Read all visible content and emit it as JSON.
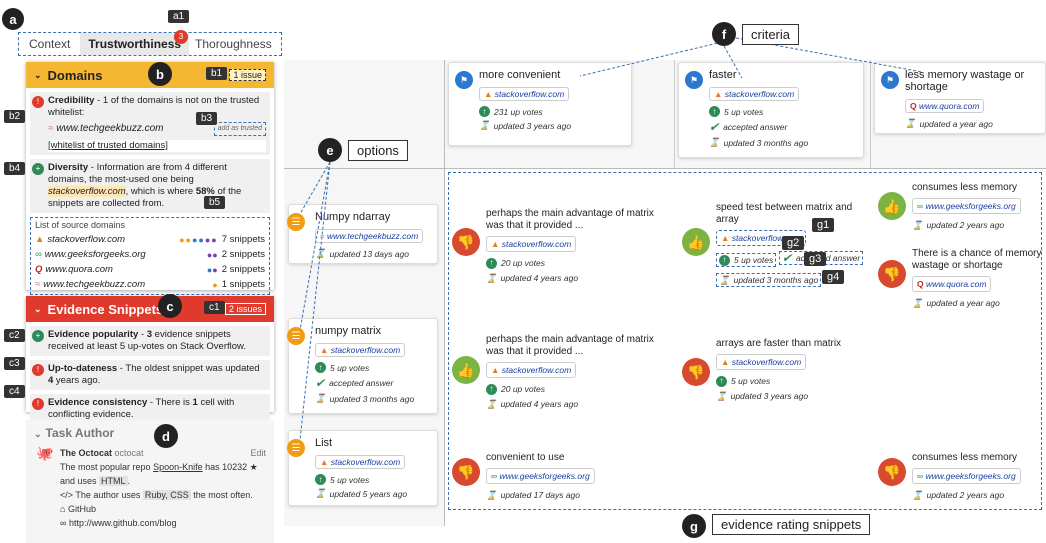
{
  "tabs": [
    "Context",
    "Trustworthiness",
    "Thoroughness"
  ],
  "tab_badge": "3",
  "labels": {
    "a": "a",
    "a1": "a1",
    "b": "b",
    "b1": "b1",
    "b2": "b2",
    "b3": "b3",
    "b4": "b4",
    "b5": "b5",
    "c": "c",
    "c1": "c1",
    "c2": "c2",
    "c3": "c3",
    "c4": "c4",
    "d": "d",
    "e": "e",
    "f": "f",
    "g": "g",
    "g1": "g1",
    "g2": "g2",
    "g3": "g3",
    "g4": "g4"
  },
  "callouts": {
    "criteria": "criteria",
    "options": "options",
    "evidence": "evidence rating snippets"
  },
  "domains": {
    "title": "Domains",
    "issues": "1 issue",
    "credibility_bold": "Credibility",
    "credibility_text": " - 1 of the domains is not on the trusted whitelist:",
    "cred_site": "www.techgeekbuzz.com",
    "add_trusted": "add as trusted",
    "whitelist": "[whitelist of trusted domains]",
    "diversity_bold": "Diversity",
    "diversity_text1": " - Information are from 4 different domains, the most-used one being ",
    "diversity_site": "stackoverflow.com",
    "diversity_text2": ", which is where ",
    "diversity_pct": "58%",
    "diversity_text3": " of the snippets are collected from.",
    "list_title": "List of source domains",
    "sources": [
      {
        "name": "stackoverflow.com",
        "count": "7 snippets"
      },
      {
        "name": "www.geeksforgeeks.org",
        "count": "2 snippets"
      },
      {
        "name": "www.quora.com",
        "count": "2 snippets"
      },
      {
        "name": "www.techgeekbuzz.com",
        "count": "1 snippets"
      }
    ]
  },
  "evidence": {
    "title": "Evidence Snippets",
    "issues": "2 issues",
    "pop_bold": "Evidence popularity",
    "pop_text1": " - ",
    "pop_n": "3",
    "pop_text2": " evidence snippets received at least 5 up-votes on Stack Overflow.",
    "up_bold": "Up-to-dateness",
    "up_text1": " - The oldest snippet was updated ",
    "up_n": "4",
    "up_text2": " years ago.",
    "con_bold": "Evidence consistency",
    "con_text1": " - There is ",
    "con_n": "1",
    "con_text2": " cell with conflicting evidence."
  },
  "author": {
    "title": "Task Author",
    "name": "The Octocat",
    "handle": "octocat",
    "edit": "Edit",
    "repo_text1": "The most popular repo ",
    "repo": "Spoon-Knife",
    "repo_text2": " has 10232 ★ and uses ",
    "lang": "HTML",
    ".": ".",
    "uses_text1": "The author uses ",
    "uses_langs": "Ruby, CSS",
    "uses_text2": " the most often.",
    "github": "GitHub",
    "blog": "http://www.github.com/blog"
  },
  "criteria": [
    {
      "title": "more convenient",
      "site": "stackoverflow.com",
      "votes": "231 up votes",
      "updated": "updated 3 years ago"
    },
    {
      "title": "faster",
      "site": "stackoverflow.com",
      "votes": "5 up votes",
      "accepted": "accepted answer",
      "updated": "updated 3 months ago"
    },
    {
      "title": "less memory wastage or shortage",
      "site": "www.quora.com",
      "updated": "updated a year ago"
    }
  ],
  "options": [
    {
      "title": "Numpy ndarray",
      "site": "www.techgeekbuzz.com",
      "updated": "updated 13 days ago"
    },
    {
      "title": "numpy matrix",
      "site": "stackoverflow.com",
      "votes": "5 up votes",
      "accepted": "accepted answer",
      "updated": "updated 3 months ago"
    },
    {
      "title": "List",
      "site": "stackoverflow.com",
      "votes": "5 up votes",
      "updated": "updated 5 years ago"
    }
  ],
  "cells": {
    "r1c1": {
      "text": "perhaps the main advantage of matrix was that it provided ...",
      "site": "stackoverflow.com",
      "votes": "20 up votes",
      "updated": "updated 4 years ago"
    },
    "r1c2": {
      "text": "speed test between matrix and array",
      "site": "stackoverflow.com",
      "votes": "5 up votes",
      "accepted": "accepted answer",
      "updated": "updated 3 months ago"
    },
    "r1c3a": {
      "text": "consumes less memory",
      "site": "www.geeksforgeeks.org",
      "updated": "updated 2 years ago"
    },
    "r1c3b": {
      "text": "There is a chance of memory wastage or shortage",
      "site": "www.quora.com",
      "updated": "updated a year ago"
    },
    "r2c1": {
      "text": "perhaps the main advantage of matrix was that it provided ...",
      "site": "stackoverflow.com",
      "votes": "20 up votes",
      "updated": "updated 4 years ago"
    },
    "r2c2": {
      "text": "arrays are faster than matrix",
      "site": "stackoverflow.com",
      "votes": "5 up votes",
      "updated": "updated 3 years ago"
    },
    "r3c1": {
      "text": "convenient to use",
      "site": "www.geeksforgeeks.org",
      "updated": "updated 17 days ago"
    },
    "r3c3": {
      "text": "consumes less memory",
      "site": "www.geeksforgeeks.org",
      "updated": "updated 2 years ago"
    }
  },
  "colors": {
    "domains_header": "#f5b731",
    "evidence_header": "#e03a2c",
    "thumb_up": "#7cb342",
    "thumb_down": "#d84a2f",
    "accent": "#3a6fb0"
  }
}
